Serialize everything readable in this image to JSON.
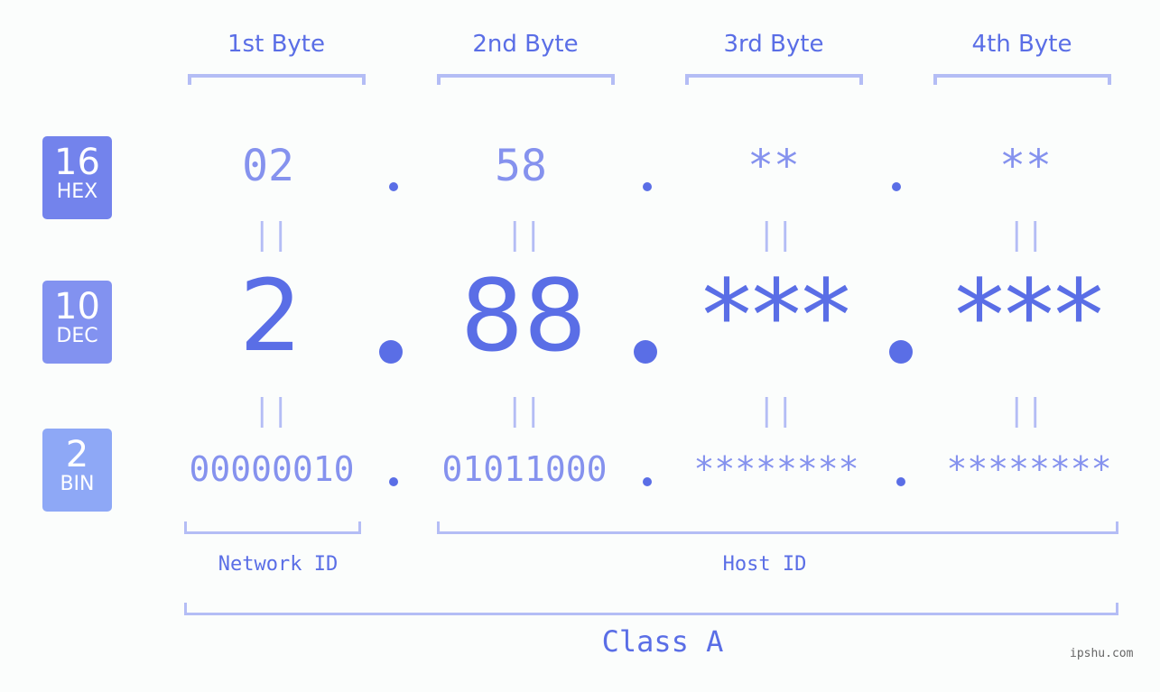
{
  "byte_headers": [
    "1st Byte",
    "2nd Byte",
    "3rd Byte",
    "4th Byte"
  ],
  "badges": {
    "hex": {
      "num": "16",
      "label": "HEX",
      "color": "#7383ec"
    },
    "dec": {
      "num": "10",
      "label": "DEC",
      "color": "#8292f0"
    },
    "bin": {
      "num": "2",
      "label": "BIN",
      "color": "#8ea8f6"
    }
  },
  "hex": [
    "02",
    "58",
    "**",
    "**"
  ],
  "dec": [
    "2",
    "88",
    "***",
    "***"
  ],
  "bin": [
    "00000010",
    "01011000",
    "********",
    "********"
  ],
  "equals_glyph": "||",
  "network_id_label": "Network ID",
  "host_id_label": "Host ID",
  "class_label": "Class A",
  "watermark": "ipshu.com"
}
